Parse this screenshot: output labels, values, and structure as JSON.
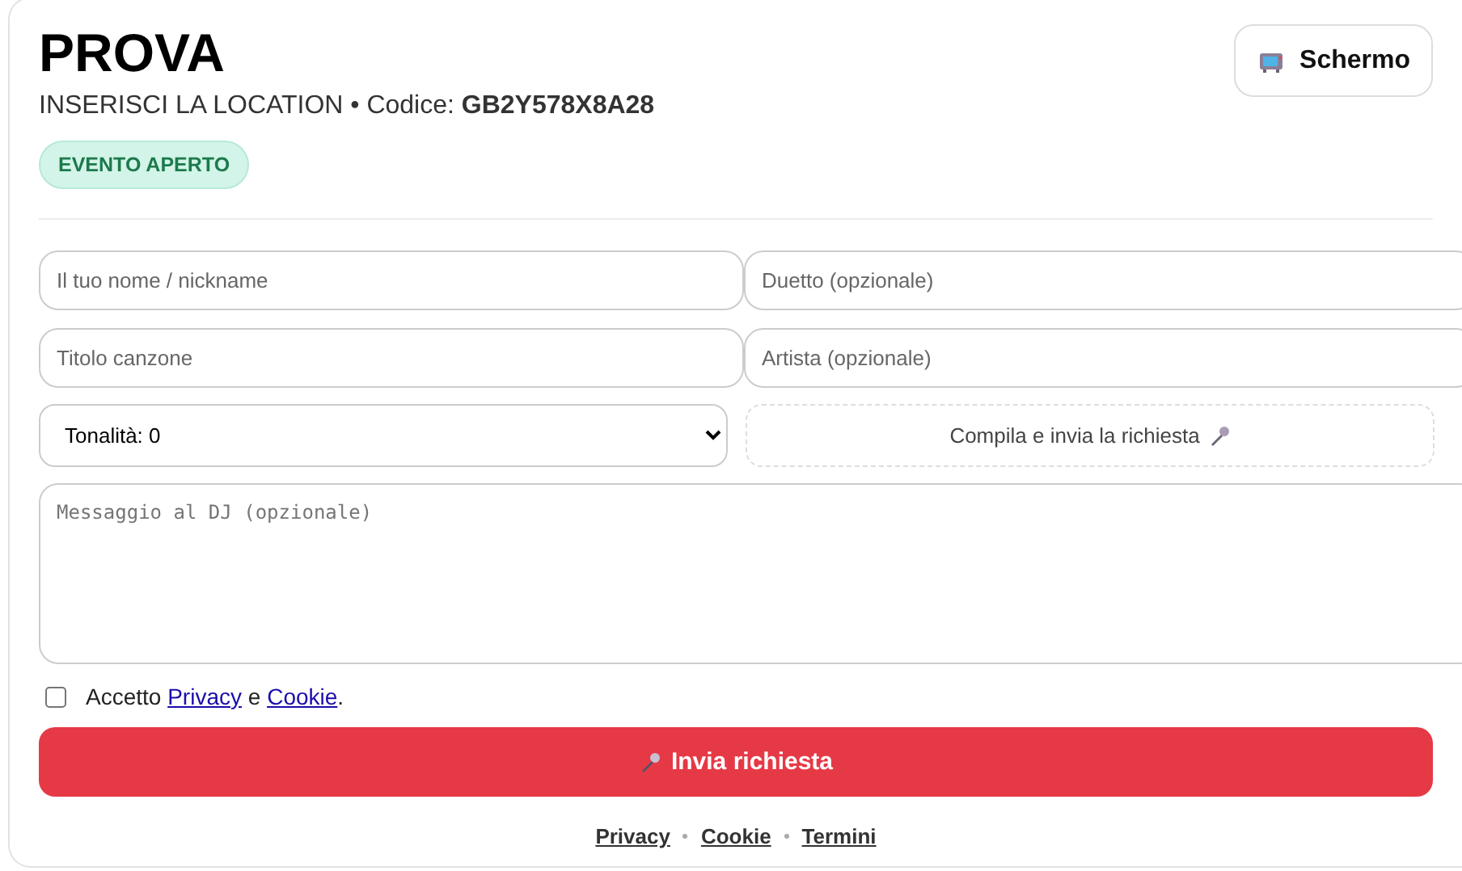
{
  "header": {
    "title": "PROVA",
    "location": "INSERISCI LA LOCATION",
    "separator": "•",
    "code_label": "Codice:",
    "code": "GB2Y578X8A28",
    "status": {
      "label": "EVENTO APERTO",
      "open": true
    },
    "screen_button": "Schermo"
  },
  "form": {
    "fields": [
      {
        "placeholder": "Il tuo nome / nickname"
      },
      {
        "placeholder": "Duetto (opzionale)"
      },
      {
        "placeholder": "Titolo canzone"
      },
      {
        "placeholder": "Artista (opzionale)"
      }
    ],
    "key_select": "Tonalità: 0",
    "hint": "Compila e invia la richiesta",
    "message_placeholder": "Messaggio al DJ (opzionale)",
    "consent": {
      "checked": false,
      "prefix": "Accetto",
      "link_1": "Privacy",
      "middle": "e",
      "link_2": "Cookie",
      "suffix": "."
    },
    "submit": "Invia richiesta"
  },
  "footer_links": [
    "Privacy",
    "Cookie",
    "Termini"
  ]
}
